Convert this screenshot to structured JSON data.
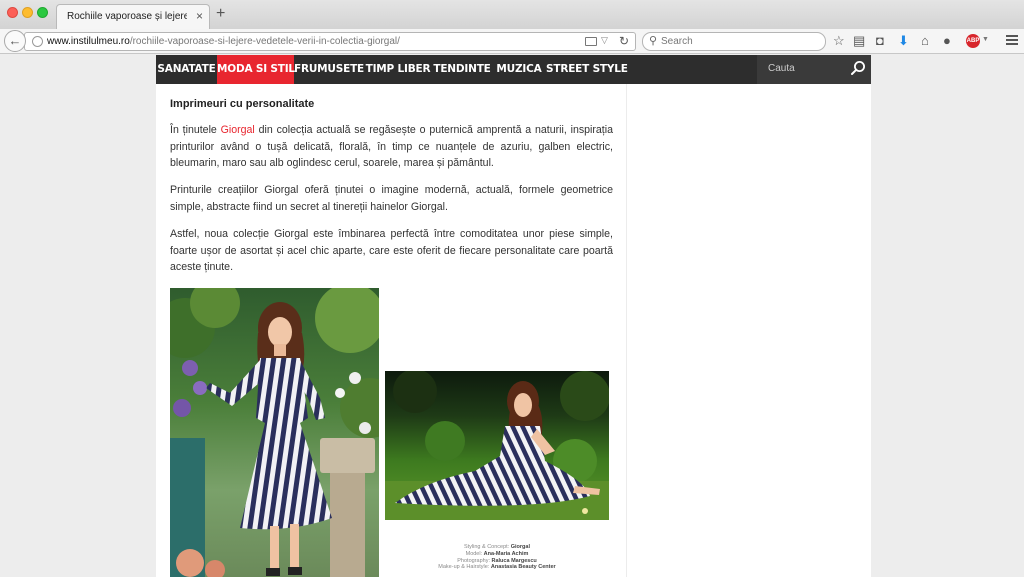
{
  "browser": {
    "tab_title": "Rochiile vaporoase și lejere, v...",
    "tab_close": "×",
    "new_tab": "+",
    "url_host": "www.instilulmeu.ro",
    "url_path": "/rochiile-vaporoase-si-lejere-vedetele-verii-in-colectia-giorgal/",
    "search_placeholder": "Search",
    "abp_label": "ABP"
  },
  "site": {
    "nav": [
      {
        "label": "SANATATE"
      },
      {
        "label": "MODA SI STIL"
      },
      {
        "label": "FRUMUSETE"
      },
      {
        "label": "TIMP LIBER"
      },
      {
        "label": "TENDINTE"
      },
      {
        "label": "MUZICA"
      },
      {
        "label": "STREET STYLE"
      }
    ],
    "active_nav": "MODA SI STIL",
    "search_placeholder": "Cauta",
    "accent_color": "#e8262f"
  },
  "article": {
    "section_title": "Imprimeuri cu personalitate",
    "p1_pre": "În ținutele ",
    "p1_link": "Giorgal",
    "p1_post": " din colecția actuală se regăsește o puternică amprentă a naturii, inspirația printurilor având o tușă delicată, florală, în timp ce nuanțele de azuriu, galben electric, bleumarin, maro sau alb oglindesc cerul, soarele, marea și pământul.",
    "p2": "Printurile creațiilor Giorgal oferă ținutei o imagine modernă, actuală, formele geometrice simple, abstracte fiind un secret al tinereții hainelor Giorgal.",
    "p3": "Astfel, noua colecție Giorgal este îmbinarea perfectă între comoditatea unor piese simple, foarte ușor de asortat și acel chic aparte, care este oferit de fiecare personalitate care poartă aceste ținute.",
    "credits": [
      {
        "label": "Styling & Concept: ",
        "value": "Giorgal"
      },
      {
        "label": "Model: ",
        "value": "Ana-Maria Achim"
      },
      {
        "label": "Photography: ",
        "value": "Raluca Margescu"
      },
      {
        "label": "Make-up & Hairstyle: ",
        "value": "Anastasia Beauty Center"
      }
    ]
  }
}
